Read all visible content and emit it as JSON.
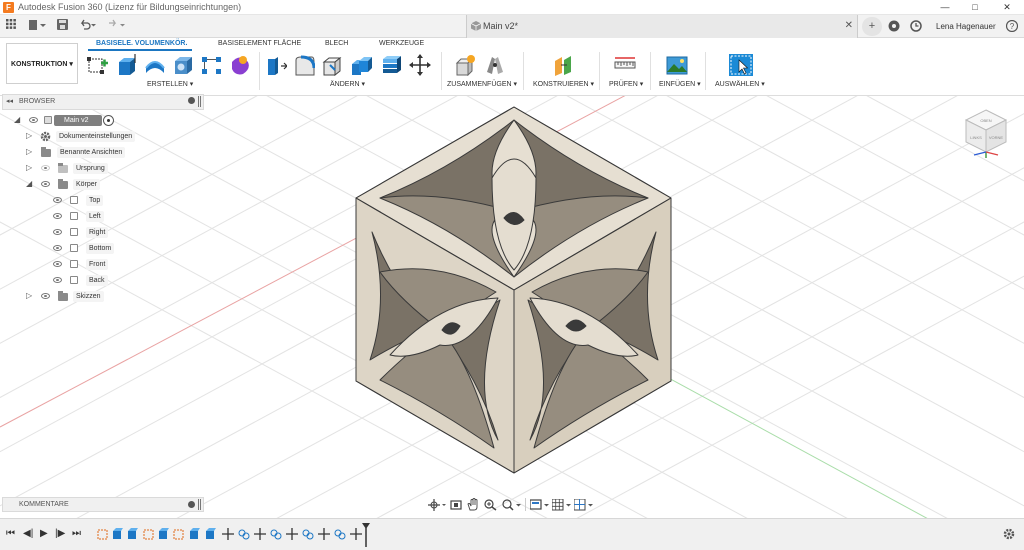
{
  "window": {
    "title": "Autodesk Fusion 360 (Lizenz für Bildungseinrichtungen)",
    "controls": [
      "—",
      "□",
      "✕"
    ]
  },
  "document": {
    "tab_name": "Main v2*",
    "close": "✕"
  },
  "user": {
    "name": "Lena Hagenauer"
  },
  "ribbon": {
    "mode": "KONSTRUKTION ▾",
    "tabs": [
      "BASISELE. VOLUMENKÖR.",
      "BASISELEMENT FLÄCHE",
      "BLECH",
      "WERKZEUGE"
    ],
    "groups": [
      "ERSTELLEN ▾",
      "ÄNDERN ▾",
      "ZUSAMMENFÜGEN ▾",
      "KONSTRUIEREN ▾",
      "PRÜFEN ▾",
      "EINFÜGEN ▾",
      "AUSWÄHLEN ▾"
    ]
  },
  "browser": {
    "title": "BROWSER",
    "root": "Main v2",
    "items": [
      "Dokumenteinstellungen",
      "Benannte Ansichten",
      "Ursprung",
      "Körper",
      "Skizzen"
    ],
    "bodies": [
      "Top",
      "Left",
      "Right",
      "Bottom",
      "Front",
      "Back"
    ]
  },
  "comments": {
    "title": "KOMMENTARE"
  },
  "viewcube": {
    "faces": [
      "OBEN",
      "LINKS",
      "VORNE"
    ]
  },
  "colors": {
    "accent": "#1b76c1",
    "model_fill": "#e4ddd0",
    "model_shadow": "#c7bdab",
    "model_edge": "#3a3a3a",
    "grid": "#e6e6e6",
    "x_axis": "#e07070",
    "y_axis": "#7ccf7c"
  }
}
